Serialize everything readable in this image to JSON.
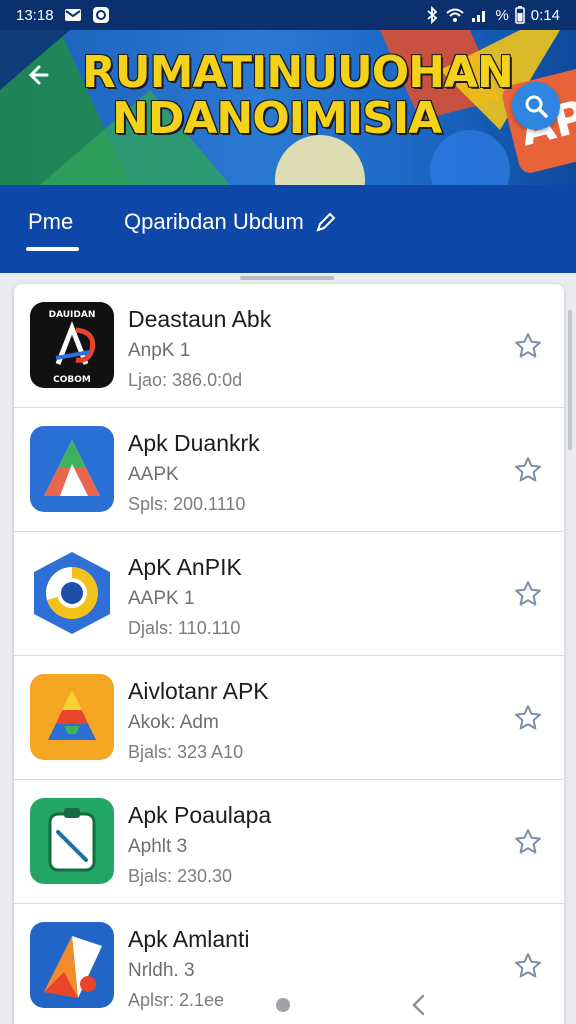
{
  "status_bar": {
    "time": "13:18",
    "right_time": "0:14",
    "battery": "%",
    "icons": [
      "mail-icon",
      "record-icon",
      "bluetooth-icon",
      "wifi-icon",
      "signal-icon"
    ]
  },
  "banner": {
    "title_line1": "RUMATINUUOHAN",
    "title_line2": "NDANOIMISIA",
    "badge": "APK",
    "back_icon": "back-arrow-icon",
    "search_icon": "search-icon"
  },
  "tabs": [
    {
      "label": "Pme",
      "active": true
    },
    {
      "label": "Qparibdan Ubdum",
      "active": false,
      "icon": "pencil-icon"
    }
  ],
  "apps": [
    {
      "name": "Deastaun Abk",
      "subtitle": "AnpK 1",
      "size": "Ljao: 386.0:0d",
      "icon_text_top": "DAUIDAN",
      "icon_text_bottom": "COBOM"
    },
    {
      "name": "Apk Duankrk",
      "subtitle": "AAPK",
      "size": "Spls: 200.1110"
    },
    {
      "name": "ApK AnPIK",
      "subtitle": "AAPK 1",
      "size": "Djals: 110.110"
    },
    {
      "name": "Aivlotanr APK",
      "subtitle": "Akok: Adm",
      "size": "Bjals: 323 A10"
    },
    {
      "name": "Apk Poaulapa",
      "subtitle": "Aphlt 3",
      "size": "Bjals: 230.30"
    },
    {
      "name": "Apk Amlanti",
      "subtitle": "Nrldh. 3",
      "size": "Aplsr: 2.1ee"
    }
  ],
  "colors": {
    "header_blue": "#0d48a8",
    "status_bar": "#0c2f6e",
    "title_yellow": "#f4d21a",
    "search_button": "#2f86e0"
  }
}
